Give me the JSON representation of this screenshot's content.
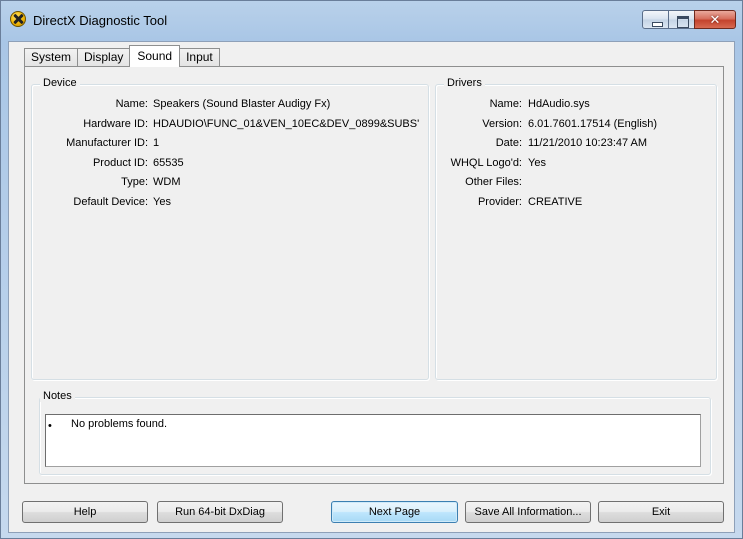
{
  "window": {
    "title": "DirectX Diagnostic Tool",
    "caption_buttons": {
      "minimize": "",
      "maximize": "",
      "close": "✕"
    }
  },
  "tabs": [
    {
      "label": "System",
      "active": false
    },
    {
      "label": "Display",
      "active": false
    },
    {
      "label": "Sound",
      "active": true
    },
    {
      "label": "Input",
      "active": false
    }
  ],
  "device": {
    "title": "Device",
    "fields": [
      {
        "key": "Name:",
        "value": "Speakers (Sound Blaster Audigy Fx)"
      },
      {
        "key": "Hardware ID:",
        "value": "HDAUDIO\\FUNC_01&VEN_10EC&DEV_0899&SUBS'"
      },
      {
        "key": "Manufacturer ID:",
        "value": "1"
      },
      {
        "key": "Product ID:",
        "value": "65535"
      },
      {
        "key": "Type:",
        "value": "WDM"
      },
      {
        "key": "Default Device:",
        "value": "Yes"
      }
    ]
  },
  "drivers": {
    "title": "Drivers",
    "fields": [
      {
        "key": "Name:",
        "value": "HdAudio.sys"
      },
      {
        "key": "Version:",
        "value": "6.01.7601.17514 (English)"
      },
      {
        "key": "Date:",
        "value": "11/21/2010 10:23:47 AM"
      },
      {
        "key": "WHQL Logo'd:",
        "value": "Yes"
      },
      {
        "key": "Other Files:",
        "value": ""
      },
      {
        "key": "Provider:",
        "value": "CREATIVE"
      }
    ]
  },
  "notes": {
    "title": "Notes",
    "bullet": "•",
    "items": [
      "No problems found."
    ]
  },
  "buttons": {
    "help": "Help",
    "run64": "Run 64-bit DxDiag",
    "next_page": "Next Page",
    "save_all": "Save All Information...",
    "exit": "Exit"
  }
}
